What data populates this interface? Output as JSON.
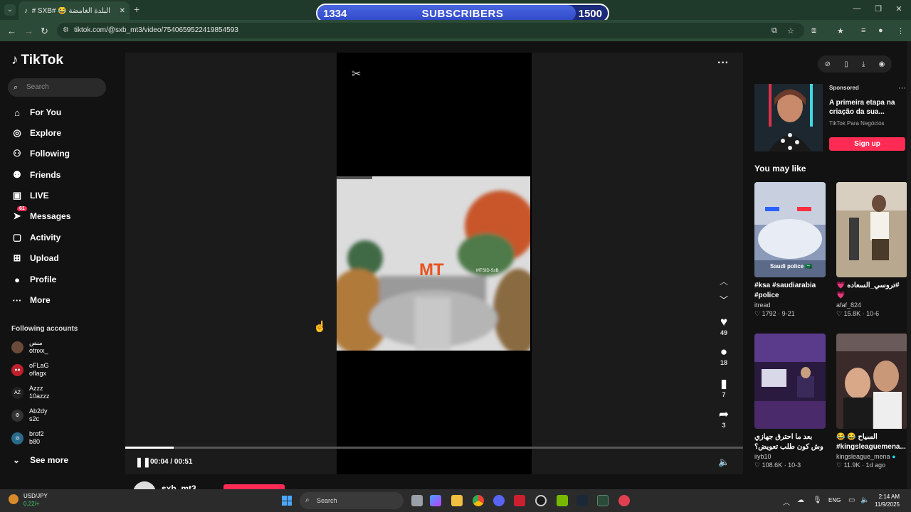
{
  "browser": {
    "tab_title": "البلدة الغامضة 😂 #SXB #",
    "url": "tiktok.com/@sxb_mt3/video/7540659522419854593",
    "new_tab": "+",
    "win_min": "—",
    "win_max": "❐",
    "win_close": "✕"
  },
  "overlay": {
    "current": "1334",
    "label": "SUBSCRIBERS",
    "goal": "1500",
    "progress_fraction": 0.89
  },
  "sidebar": {
    "logo": "TikTok",
    "search_placeholder": "Search",
    "nav": [
      {
        "label": "For You",
        "icon": "home-icon"
      },
      {
        "label": "Explore",
        "icon": "compass-icon"
      },
      {
        "label": "Following",
        "icon": "following-icon"
      },
      {
        "label": "Friends",
        "icon": "friends-icon"
      },
      {
        "label": "LIVE",
        "icon": "live-icon"
      },
      {
        "label": "Messages",
        "icon": "messages-icon",
        "badge": "61"
      },
      {
        "label": "Activity",
        "icon": "activity-icon"
      },
      {
        "label": "Upload",
        "icon": "upload-icon"
      },
      {
        "label": "Profile",
        "icon": "profile-icon"
      },
      {
        "label": "More",
        "icon": "more-icon"
      }
    ],
    "following_title": "Following accounts",
    "accounts": [
      {
        "name": "منص",
        "handle": "otnxx_"
      },
      {
        "name": "oFLaG",
        "handle": "oflagx"
      },
      {
        "name": "Azzz",
        "handle": "10azzz"
      },
      {
        "name": "Ab2dy",
        "handle": "s2c"
      },
      {
        "name": "brof2",
        "handle": "b80"
      }
    ],
    "see_more": "See more"
  },
  "video": {
    "watermark": "MT",
    "watermark_sub": "MTSID-SxB",
    "time": "00:04 / 00:51",
    "progress_fraction": 0.078,
    "likes": "49",
    "comments": "18",
    "saves": "7",
    "shares": "3",
    "author": "sxb_mt3"
  },
  "ad": {
    "sponsored": "Sponsored",
    "title": "A primeira etapa na criação da sua...",
    "sub": "TikTok Para Negócios",
    "cta": "Sign up"
  },
  "recommend": {
    "title": "You may like",
    "cards": [
      {
        "caption": "#ksa #saudiarabia #police",
        "author": "itread",
        "likes": "1792",
        "date": "9-21",
        "overlay": "Saudi police 🇸🇦"
      },
      {
        "caption": "#تروسي_السعاده 💗 💗",
        "author": "afaf_824",
        "likes": "15.8K",
        "date": "10-6",
        "overlay": ""
      },
      {
        "caption": "بعد ما احترق جهازي وش كون طلب تعويض؟ ...",
        "author": "iiyb10",
        "likes": "108.6K",
        "date": "10-3",
        "overlay": ""
      },
      {
        "caption": "😂 😂 السياح #kingsleaguemena...",
        "author": "kingsleague_mena",
        "likes": "11.9K",
        "date": "1d ago",
        "overlay": ""
      }
    ]
  },
  "taskbar": {
    "ticker_name": "USD/JPY",
    "ticker_val": "0.22/+",
    "search": "Search",
    "lang": "ENG",
    "time": "2:14 AM",
    "date": "11/9/2025"
  }
}
